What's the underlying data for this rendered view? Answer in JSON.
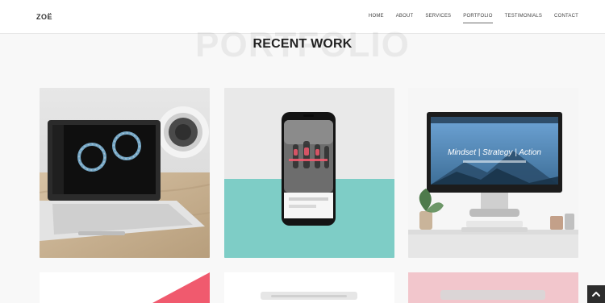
{
  "brand": {
    "logo": "ZOË"
  },
  "nav": {
    "items": [
      "HOME",
      "ABOUT",
      "SERVICES",
      "PORTFOLIO",
      "TESTIMONIALS",
      "CONTACT"
    ],
    "active": "PORTFOLIO"
  },
  "section": {
    "background_word": "PORTFOLIO",
    "title": "RECENT WORK"
  },
  "portfolio": {
    "items": [
      {
        "name": "jewelry-site-laptop-mockup"
      },
      {
        "name": "fitness-site-phone-mockup"
      },
      {
        "name": "desktop-site-imac-mockup",
        "headline": "Mindset | Strategy | Action"
      }
    ]
  },
  "colors": {
    "accent_teal": "#7ecdc6",
    "accent_pink": "#f05a6e",
    "row2_pink": "#f2c6cc",
    "scroll_button": "#2d2d2d"
  },
  "icons": {
    "scroll_top": "chevron-up-icon"
  }
}
